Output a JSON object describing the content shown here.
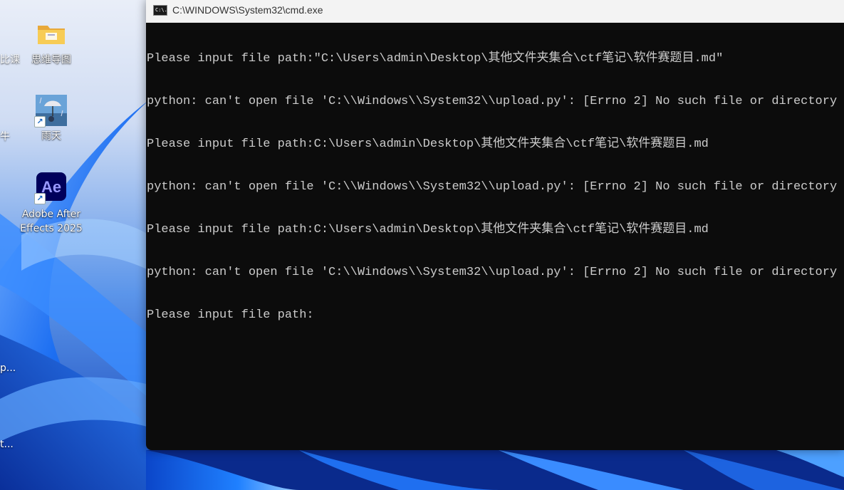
{
  "desktop": {
    "icons": [
      {
        "label": "思维导图",
        "icon": "folder-icon"
      },
      {
        "label": "雨天",
        "icon": "rain-image-icon"
      },
      {
        "label": "Adobe After Effects 2025",
        "line1": "Adobe After",
        "line2": "Effects 2025",
        "icon": "after-effects-icon",
        "badge": "Ae"
      }
    ],
    "partial_labels": [
      "比课",
      "牛",
      "p...",
      "t..."
    ]
  },
  "window": {
    "title": "C:\\WINDOWS\\System32\\cmd.exe",
    "icon_text": "C:\\.",
    "console_lines": [
      "Please input file path:\"C:\\Users\\admin\\Desktop\\其他文件夹集合\\ctf笔记\\软件赛题目.md\"",
      "python: can't open file 'C:\\\\Windows\\\\System32\\\\upload.py': [Errno 2] No such file or directory",
      "Please input file path:C:\\Users\\admin\\Desktop\\其他文件夹集合\\ctf笔记\\软件赛题目.md",
      "python: can't open file 'C:\\\\Windows\\\\System32\\\\upload.py': [Errno 2] No such file or directory",
      "Please input file path:C:\\Users\\admin\\Desktop\\其他文件夹集合\\ctf笔记\\软件赛题目.md",
      "python: can't open file 'C:\\\\Windows\\\\System32\\\\upload.py': [Errno 2] No such file or directory",
      "Please input file path:"
    ]
  },
  "colors": {
    "console_bg": "#0c0c0c",
    "console_text": "#cccccc",
    "titlebar_bg": "#f3f3f3",
    "accent_ae": "#9999ff",
    "ae_bg": "#00005b"
  }
}
